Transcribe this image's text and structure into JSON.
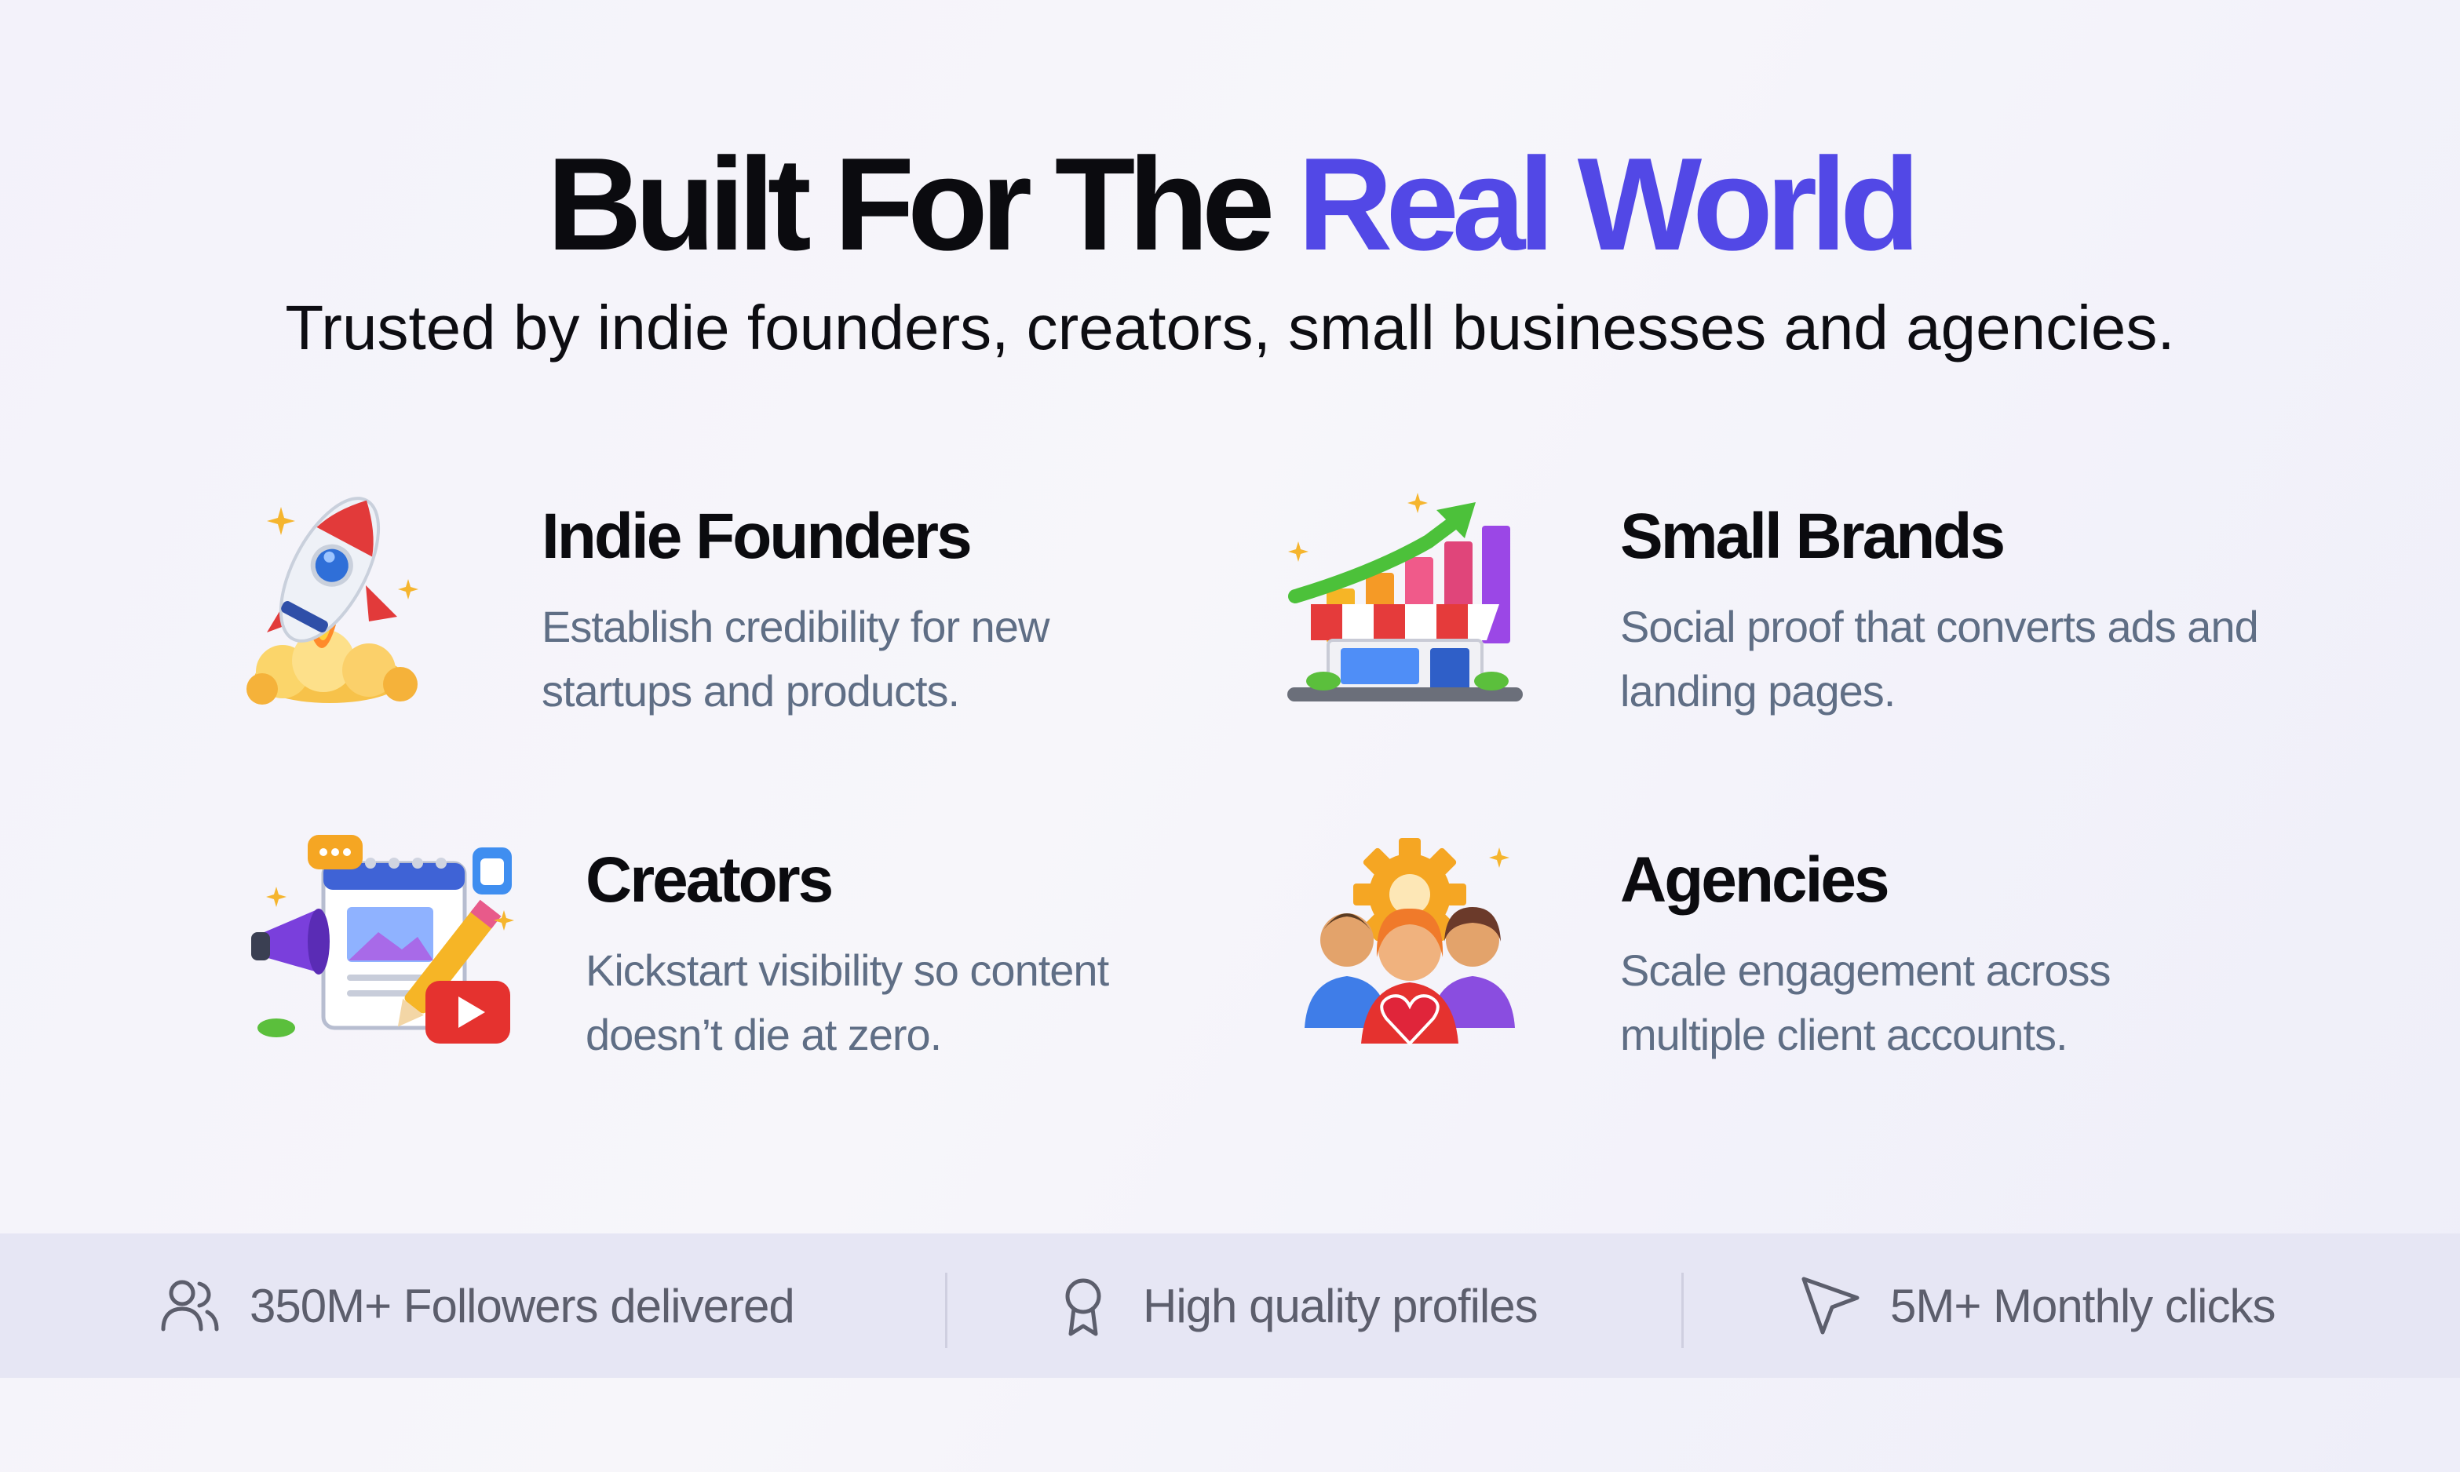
{
  "hero": {
    "title_main": "Built For The ",
    "title_accent": "Real World",
    "subtitle": "Trusted by indie founders, creators, small businesses and agencies."
  },
  "audiences": [
    {
      "title": "Indie Founders",
      "description": "Establish credibility for new startups and products.",
      "icon": "rocket-icon"
    },
    {
      "title": "Small Brands",
      "description": "Social proof that converts ads and landing pages.",
      "icon": "storefront-growth-icon"
    },
    {
      "title": "Creators",
      "description": "Kickstart visibility so content doesn’t die at zero.",
      "icon": "creator-tools-icon"
    },
    {
      "title": "Agencies",
      "description": "Scale engagement across multiple client accounts.",
      "icon": "team-gear-icon"
    }
  ],
  "stats": [
    {
      "label": "350M+ Followers delivered",
      "icon": "users-icon"
    },
    {
      "label": "High quality profiles",
      "icon": "award-badge-icon"
    },
    {
      "label": "5M+ Monthly clicks",
      "icon": "cursor-pointer-icon"
    }
  ],
  "colors": {
    "accent": "#5248e6",
    "heading": "#0b0b0f",
    "body_text": "#5f6e85",
    "stats_bar": "#e6e6f4",
    "stats_text": "#5c5e6c"
  }
}
